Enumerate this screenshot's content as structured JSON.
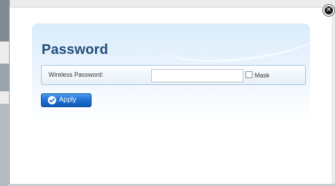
{
  "dialog": {
    "title": "Password",
    "close_icon": "close-icon"
  },
  "wireless": {
    "label": "Wireless Password:",
    "value": "",
    "placeholder": "",
    "mask_label": "Mask",
    "mask_checked": false
  },
  "actions": {
    "apply_label": "Apply",
    "apply_icon": "checkmark-icon"
  },
  "colors": {
    "title": "#1f4e79",
    "apply_button": "#1c6fd1",
    "panel": "#d9ebfb"
  }
}
